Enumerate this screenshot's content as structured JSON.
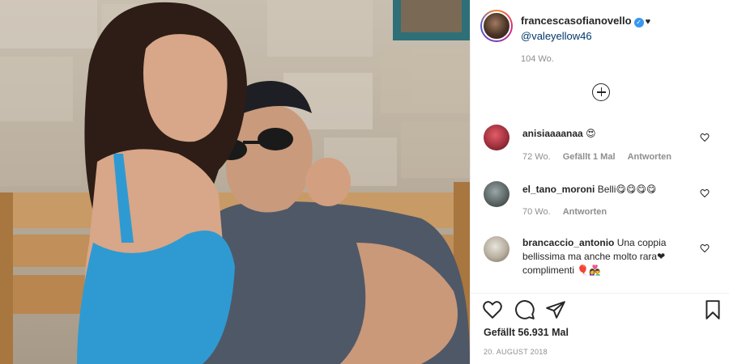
{
  "post": {
    "username": "francescasofianovello",
    "verified_icon": "verified-check-icon",
    "heart": "♥",
    "caption_mention": "@valeyellow46",
    "time_ago": "104 Wo.",
    "likes": "Gefällt 56.931 Mal",
    "date": "20. AUGUST 2018"
  },
  "comments": [
    {
      "user": "anisiaaaanaa",
      "text": "😍",
      "time": "72 Wo.",
      "likes": "Gefällt 1 Mal",
      "reply": "Antworten"
    },
    {
      "user": "el_tano_moroni",
      "text": "Belli😋😋😋😋",
      "time": "70 Wo.",
      "reply": "Antworten"
    },
    {
      "user": "brancaccio_antonio",
      "text": "Una coppia bellissima ma anche molto rara❤ complimenti 🎈👩‍❤️‍👨"
    }
  ],
  "colors": {
    "link": "#00376b",
    "muted": "#8e8e8e",
    "verified": "#3897f0"
  }
}
